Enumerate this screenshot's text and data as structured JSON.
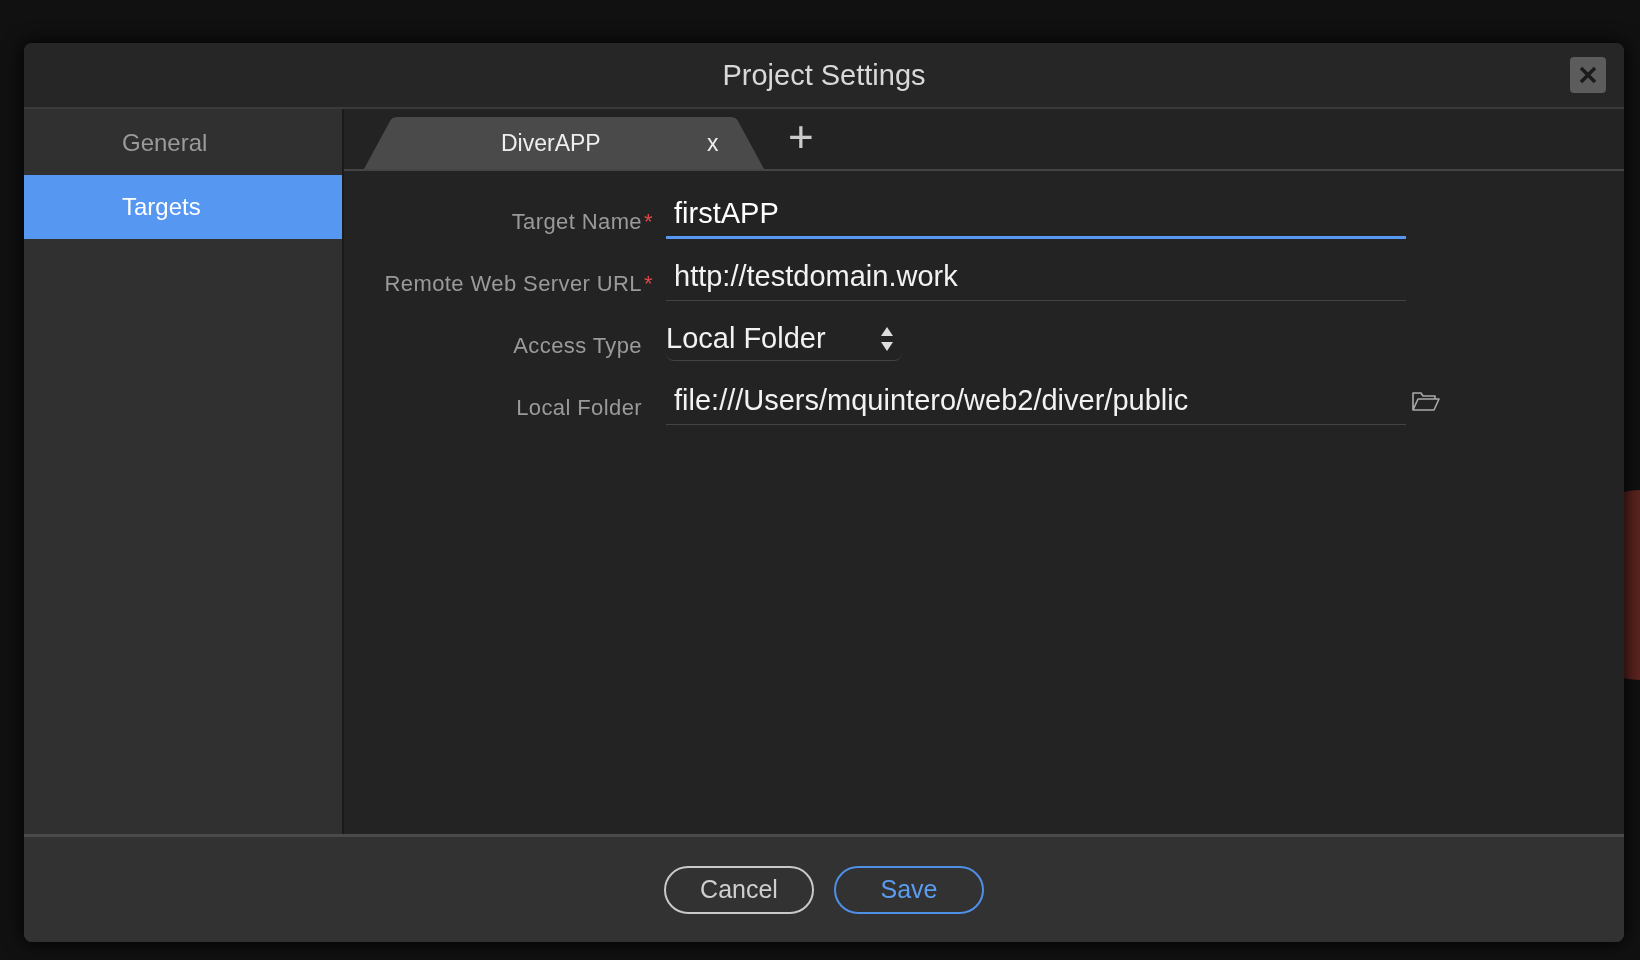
{
  "window": {
    "title": "Project Settings"
  },
  "sidebar": {
    "items": [
      {
        "label": "General",
        "selected": false
      },
      {
        "label": "Targets",
        "selected": true
      }
    ]
  },
  "tabs": [
    {
      "label": "DiverAPP",
      "close": "x",
      "selected": true
    }
  ],
  "add_tab": "+",
  "fields": [
    {
      "kind": "text",
      "label": "Target Name",
      "required": true,
      "value": "firstAPP",
      "focused": true
    },
    {
      "kind": "text",
      "label": "Remote Web Server URL",
      "required": true,
      "value": "http://testdomain.work",
      "focused": false
    },
    {
      "kind": "select",
      "label": "Access Type",
      "required": false,
      "value": "Local Folder"
    },
    {
      "kind": "folder",
      "label": "Local Folder",
      "required": false,
      "value": "file:///Users/mquintero/web2/diver/public",
      "focused": false
    }
  ],
  "required_mark": "*",
  "buttons": [
    {
      "label": "Cancel",
      "primary": false
    },
    {
      "label": "Save",
      "primary": true
    }
  ]
}
